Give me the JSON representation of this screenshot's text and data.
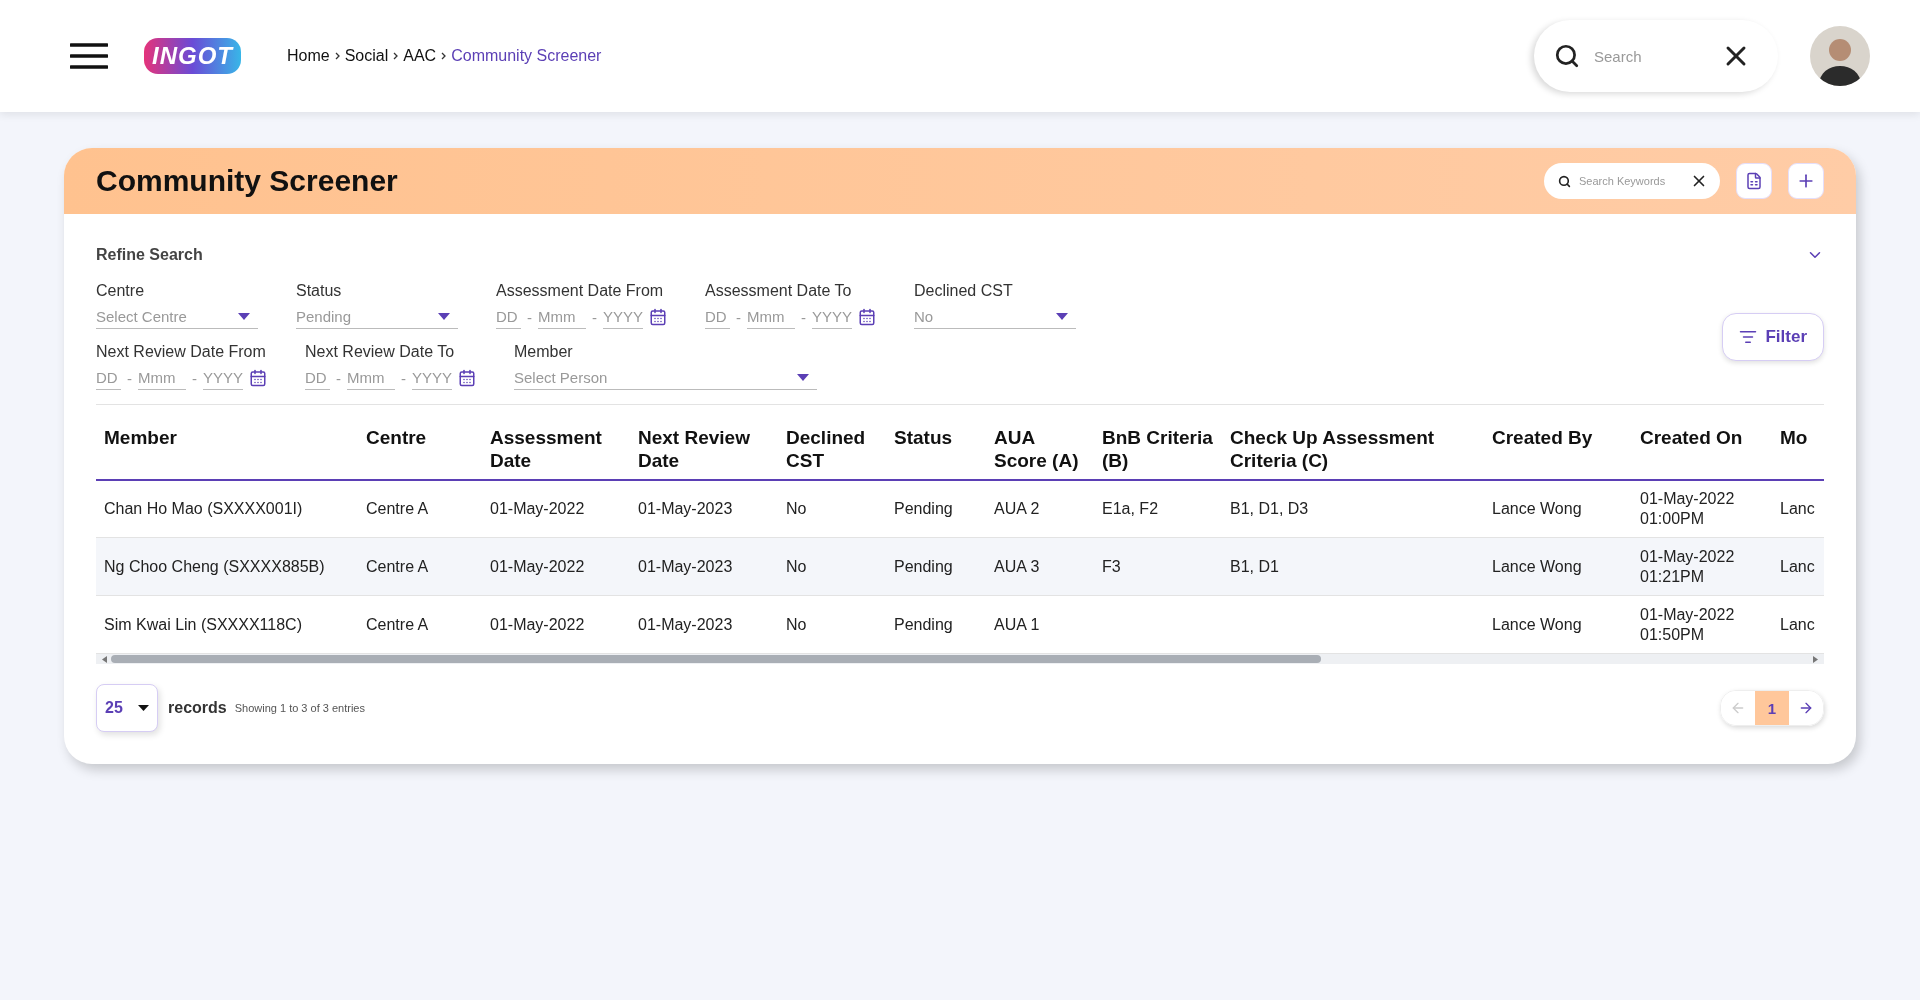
{
  "topbar": {
    "logo": "INGOT",
    "breadcrumb": [
      {
        "label": "Home",
        "current": false
      },
      {
        "label": "Social",
        "current": false
      },
      {
        "label": "AAC",
        "current": false
      },
      {
        "label": "Community Screener",
        "current": true
      }
    ],
    "search": {
      "placeholder": "Search"
    }
  },
  "panel": {
    "title": "Community Screener",
    "keyword_search": {
      "placeholder": "Search Keywords"
    }
  },
  "refine": {
    "title": "Refine Search",
    "expanded": true,
    "filter_button": "Filter",
    "rows": [
      [
        {
          "kind": "select",
          "label": "Centre",
          "value": "Select Centre"
        },
        {
          "kind": "select",
          "label": "Status",
          "value": "Pending"
        },
        {
          "kind": "date",
          "label": "Assessment Date From",
          "parts": [
            "DD",
            "Mmm",
            "YYYY"
          ],
          "separator": "-"
        },
        {
          "kind": "date",
          "label": "Assessment Date To",
          "parts": [
            "DD",
            "Mmm",
            "YYYY"
          ],
          "separator": "-"
        },
        {
          "kind": "select",
          "label": "Declined CST",
          "value": "No"
        }
      ],
      [
        {
          "kind": "date",
          "label": "Next Review Date From",
          "parts": [
            "DD",
            "Mmm",
            "YYYY"
          ],
          "separator": "-"
        },
        {
          "kind": "date",
          "label": "Next Review Date To",
          "parts": [
            "DD",
            "Mmm",
            "YYYY"
          ],
          "separator": "-"
        },
        {
          "kind": "person",
          "label": "Member",
          "value": "Select Person"
        }
      ]
    ]
  },
  "table": {
    "columns": [
      "Member",
      "Centre",
      "Assessment Date",
      "Next Review Date",
      "Declined CST",
      "Status",
      "AUA Score (A)",
      "BnB Criteria (B)",
      "Check Up Assessment Criteria (C)",
      "Created By",
      "Created On",
      "Mo"
    ],
    "rows": [
      [
        "Chan Ho Mao (SXXXX001I)",
        "Centre A",
        "01-May-2022",
        "01-May-2023",
        "No",
        "Pending",
        "AUA 2",
        "E1a, F2",
        "B1, D1, D3",
        "Lance Wong",
        "01-May-2022 01:00PM",
        "Lanc"
      ],
      [
        "Ng Choo Cheng (SXXXX885B)",
        "Centre A",
        "01-May-2022",
        "01-May-2023",
        "No",
        "Pending",
        "AUA 3",
        "F3",
        "B1, D1",
        "Lance Wong",
        "01-May-2022 01:21PM",
        "Lanc"
      ],
      [
        "Sim Kwai Lin (SXXXX118C)",
        "Centre A",
        "01-May-2022",
        "01-May-2023",
        "No",
        "Pending",
        "AUA 1",
        "",
        "",
        "Lance Wong",
        "01-May-2022 01:50PM",
        "Lanc"
      ]
    ]
  },
  "footer": {
    "page_size": "25",
    "records_label": "records",
    "summary": "Showing 1 to 3 of 3 entries",
    "pages": [
      {
        "label": "1",
        "selected": true
      }
    ],
    "prev_disabled": true,
    "next_disabled": false
  }
}
